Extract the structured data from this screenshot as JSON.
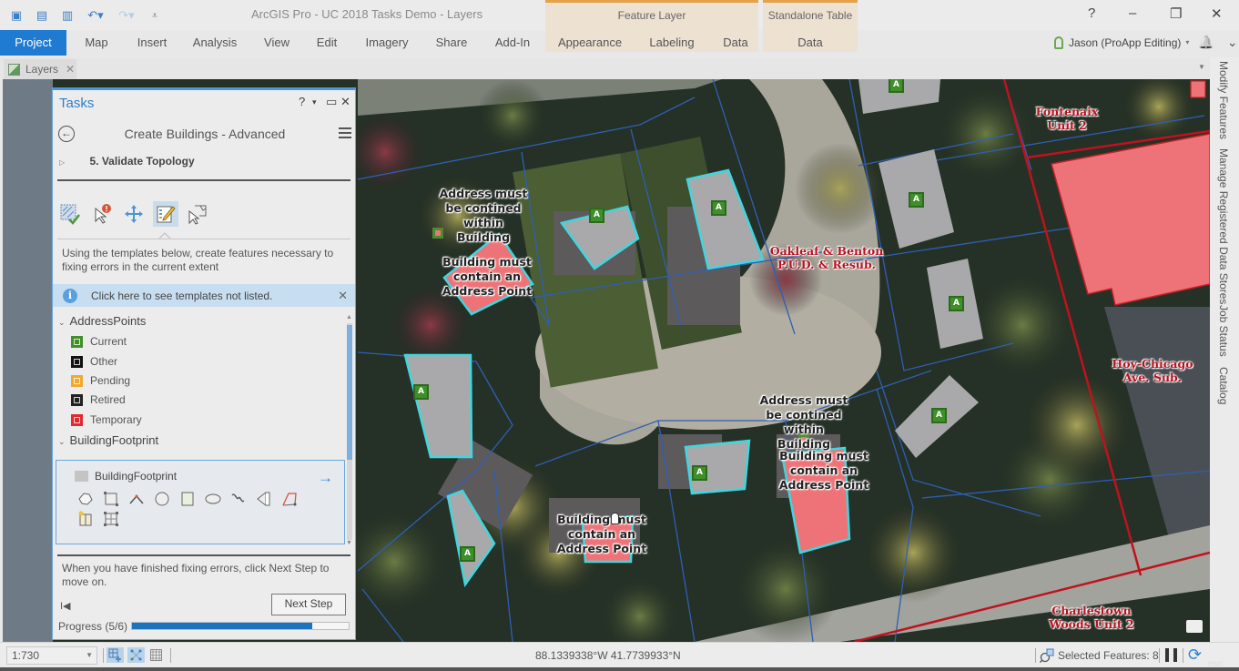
{
  "window": {
    "title": "ArcGIS Pro - UC 2018 Tasks Demo - Layers",
    "help": "?",
    "minimize": "–",
    "restore": "❐",
    "close": "✕"
  },
  "quick_access": [
    {
      "name": "new-project-icon",
      "glyph": "▣"
    },
    {
      "name": "open-project-icon",
      "glyph": "▤"
    },
    {
      "name": "save-project-icon",
      "glyph": "▥"
    },
    {
      "name": "undo-icon",
      "glyph": "↶▾"
    },
    {
      "name": "redo-icon",
      "glyph": "↷▾"
    },
    {
      "name": "customize-qat-icon",
      "glyph": "⩡"
    }
  ],
  "ribbon": {
    "tabs": [
      "Project",
      "Map",
      "Insert",
      "Analysis",
      "View",
      "Edit",
      "Imagery",
      "Share",
      "Add-In"
    ],
    "contextual": [
      {
        "group": "Feature Layer",
        "tabs": [
          "Appearance",
          "Labeling",
          "Data"
        ]
      },
      {
        "group": "Standalone Table",
        "tabs": [
          "Data"
        ]
      }
    ],
    "user": "Jason (ProApp Editing)",
    "user_caret": "▾",
    "bell": "🔔",
    "expand": "⌄"
  },
  "doc_tab": {
    "label": "Layers",
    "close": "✕"
  },
  "right_dock": [
    "Modify Features",
    "Manage Registered Data Stores",
    "Job Status",
    "Catalog"
  ],
  "tasks_pane": {
    "title": "Tasks",
    "controls": {
      "help": "?",
      "menu": "▾",
      "maximize": "▭",
      "close": "✕"
    },
    "back": "←",
    "task_name": "Create Buildings - Advanced",
    "step_expander": "▷",
    "step": "5.  Validate Topology",
    "tools": [
      {
        "name": "validate-icon",
        "active": false
      },
      {
        "name": "error-inspector-icon",
        "active": false
      },
      {
        "name": "move-icon",
        "active": false
      },
      {
        "name": "create-features-icon",
        "active": true
      },
      {
        "name": "modify-vertices-icon",
        "active": false
      }
    ],
    "instructions": "Using the templates below, create features necessary to fixing errors in the current extent",
    "info_bar": {
      "icon": "i",
      "text": "Click here to see templates not listed.",
      "close": "✕"
    },
    "groups": [
      {
        "name": "AddressPoints",
        "chevron": "⌄",
        "templates": [
          {
            "label": "Current",
            "color": "#3f8f2a"
          },
          {
            "label": "Other",
            "color": "#111111"
          },
          {
            "label": "Pending",
            "color": "#f0a830"
          },
          {
            "label": "Retired",
            "color": "#222222"
          },
          {
            "label": "Temporary",
            "color": "#e0282e"
          }
        ]
      },
      {
        "name": "BuildingFootprint",
        "chevron": "⌄",
        "templates": [
          {
            "label": "BuildingFootprint",
            "color": "#c4c4c4"
          }
        ]
      }
    ],
    "construction_tools": [
      "polygon-tool",
      "right-angle-tool",
      "arc-tool",
      "circle-tool",
      "rectangle-tool",
      "ellipse-tool",
      "freehand-tool",
      "autocomplete-tool",
      "trace-tool",
      "split-tool",
      "grid-tool"
    ],
    "template_arrow": "→",
    "footer": "When you have finished fixing errors, click Next Step to move on.",
    "first_step": "I◀",
    "next_button": "Next Step",
    "progress_label": "Progress (5/6)",
    "progress_fraction": 0.833
  },
  "map": {
    "error_labels": [
      "Address must be contined within Building",
      "Building must contain an Address Point",
      "Address must be contined within Building",
      "Building must contain an Address Point",
      "Building must contain an Address Point"
    ],
    "subdivision_labels": [
      "Oakleaf & Benton P.U.D. & Resub.",
      "Fontenaix Unit 2",
      "Hoy-Chicago Ave. Sub.",
      "Charlestown Woods Unit 2"
    ],
    "address_point_glyph": "A",
    "colors": {
      "building_fill": "#a9a9ab",
      "selection": "#3fd6de",
      "error_fill": "#ee7378",
      "parcel_line": "#2e5fb5",
      "subdivision_line": "#c0121d",
      "address_point": "#3f8f2a"
    }
  },
  "status_bar": {
    "scale": "1:730",
    "coords": "88.1339338°W 41.7739933°N",
    "selected": "Selected Features: 8"
  },
  "watermark": "esri"
}
